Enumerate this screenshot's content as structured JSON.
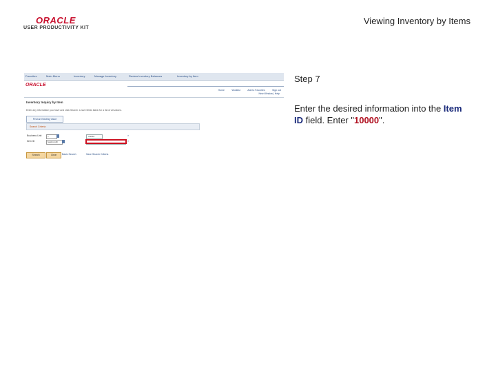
{
  "header": {
    "logo_text": "ORACLE",
    "logo_subtitle": "USER PRODUCTIVITY KIT",
    "slide_title": "Viewing Inventory by Items"
  },
  "screenshot": {
    "nav_crumbs": [
      "Favorites",
      "Main Menu",
      "Inventory",
      "Manage Inventory",
      "Review Inventory Balances",
      "Inventory by Item"
    ],
    "brand": "ORACLE",
    "top_links": [
      "Home",
      "Worklist",
      "Add to Favorites",
      "Sign out"
    ],
    "new_window": "New Window | Help",
    "page_title": "Inventory Inquiry by Item",
    "instructions": "Enter any information you have and click Search. Leave fields blank for a list of all values.",
    "find_button": "Find an Existing Value",
    "criteria_header": "Search Criteria",
    "fields": [
      {
        "label": "Business Unit",
        "operator": "=",
        "value": "US010"
      },
      {
        "label": "Item ID",
        "operator": "begins with",
        "value": ""
      }
    ],
    "search_button": "Search",
    "clear_button": "Clear",
    "basic_search_link": "Basic Search",
    "save_search_link": "Save Search Criteria"
  },
  "step": {
    "label": "Step 7",
    "text_before": "Enter the desired information into the ",
    "field_name": "Item ID",
    "text_middle": " field. Enter \"",
    "entry_value": "10000",
    "text_after": "\"."
  },
  "colors": {
    "oracle_red": "#c8102e",
    "highlight_red": "#cc1020",
    "field_blue": "#1a2a7a"
  }
}
